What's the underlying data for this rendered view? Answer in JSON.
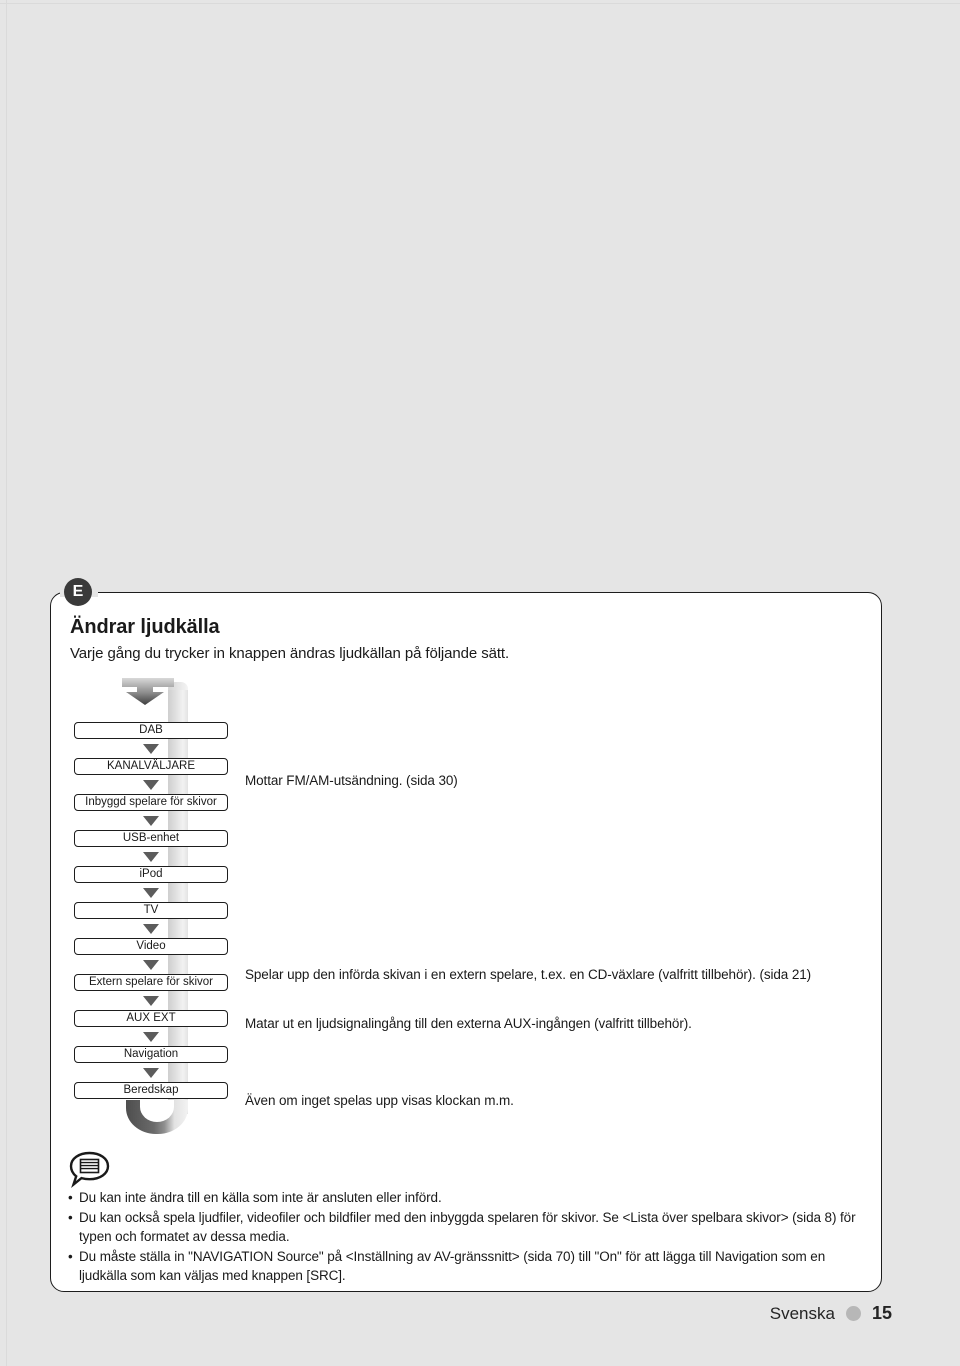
{
  "page": {
    "section_letter": "E",
    "heading": "Ändrar ljudkälla",
    "subheading": "Varje gång du trycker in knappen ändras ljudkällan på följande sätt."
  },
  "flow": {
    "items": [
      {
        "label": "DAB"
      },
      {
        "label": "KANALVÄLJARE"
      },
      {
        "label": "Inbyggd spelare för skivor"
      },
      {
        "label": "USB-enhet"
      },
      {
        "label": "iPod"
      },
      {
        "label": "TV"
      },
      {
        "label": "Video"
      },
      {
        "label": "Extern spelare för skivor"
      },
      {
        "label": "AUX EXT"
      },
      {
        "label": "Navigation"
      },
      {
        "label": "Beredskap"
      }
    ]
  },
  "descriptions": [
    {
      "text": "Mottar FM/AM-utsändning. (sida 30)"
    },
    {
      "text": "Spelar upp den införda skivan i en extern spelare, t.ex. en CD-växlare (valfritt tillbehör). (sida 21)"
    },
    {
      "text": "Matar ut en ljudsignalingång till den externa AUX-ingången (valfritt tillbehör)."
    },
    {
      "text": "Även om inget spelas upp visas klockan m.m."
    }
  ],
  "notes": {
    "icon": "memo-bubble-icon",
    "bullet": "•",
    "items": [
      "Du kan inte ändra till en källa som inte är ansluten eller införd.",
      "Du kan också spela ljudfiler, videofiler och bildfiler med den inbyggda spelaren för skivor. Se <Lista över spelbara skivor> (sida 8) för typen och formatet av dessa media.",
      "Du måste ställa in \"NAVIGATION Source\" på <Inställning av AV-gränssnitt> (sida 70) till \"On\" för att lägga till Navigation som en ljudkälla som kan väljas med knappen [SRC]."
    ]
  },
  "footer": {
    "language": "Svenska",
    "page_number": "15"
  },
  "colors": {
    "background": "#e5e5e5",
    "panel": "#ffffff",
    "ink": "#1a1a1a",
    "badge": "#3a3a3a",
    "arrow": "#5c5c5c",
    "footer_dot": "#b7b7b7"
  }
}
